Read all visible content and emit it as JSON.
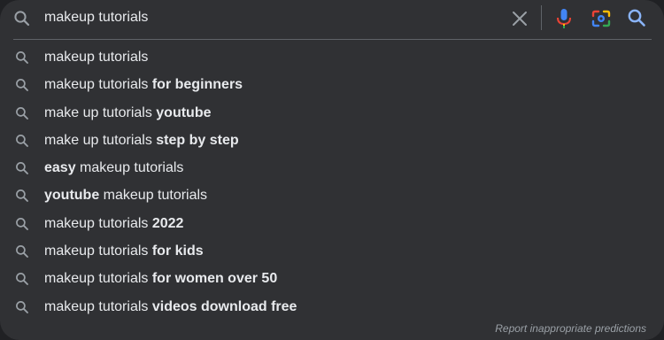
{
  "search": {
    "query": "makeup tutorials",
    "icons": {
      "search": "search-icon",
      "clear": "close-icon",
      "voice": "microphone-icon",
      "image": "camera-lens-icon",
      "submit": "search-icon"
    }
  },
  "suggestions": [
    {
      "prefix": "makeup tutorials",
      "bold": ""
    },
    {
      "prefix": "makeup tutorials ",
      "bold": "for beginners"
    },
    {
      "prefix": "make up tutorials ",
      "bold": "youtube"
    },
    {
      "prefix": "make up tutorials ",
      "bold": "step by step"
    },
    {
      "prefix": "easy",
      "bold": "",
      "suffix": " makeup tutorials",
      "bold_first": true
    },
    {
      "prefix": "youtube",
      "bold": "",
      "suffix": " makeup tutorials",
      "bold_first": true
    },
    {
      "prefix": "makeup tutorials ",
      "bold": "2022"
    },
    {
      "prefix": "makeup tutorials ",
      "bold": "for kids"
    },
    {
      "prefix": "makeup tutorials ",
      "bold": "for women over 50"
    },
    {
      "prefix": "makeup tutorials ",
      "bold": "videos download free"
    }
  ],
  "footer": {
    "report_label": "Report inappropriate predictions"
  },
  "colors": {
    "panel_bg": "#303134",
    "page_bg": "#202124",
    "text": "#e8eaed",
    "muted": "#9aa0a6",
    "accent_blue": "#8ab4f8",
    "google_blue": "#4285f4",
    "google_red": "#ea4335",
    "google_yellow": "#fbbc04",
    "google_green": "#34a853"
  }
}
